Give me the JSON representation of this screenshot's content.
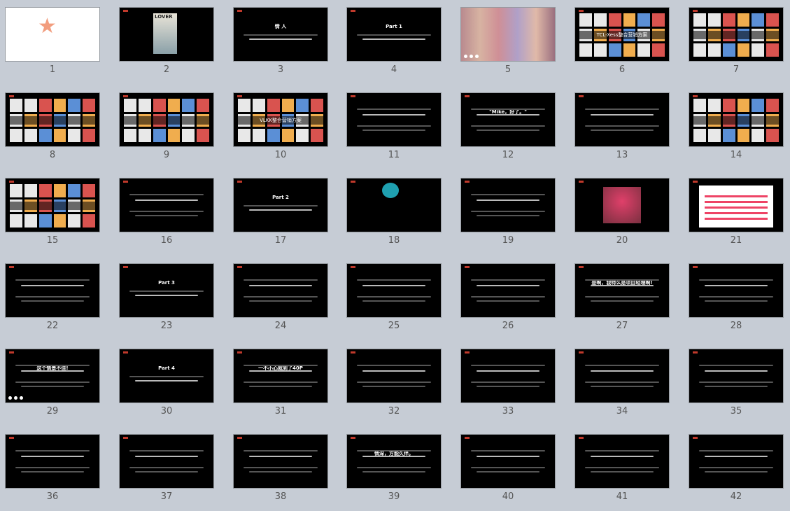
{
  "slides": [
    {
      "number": "1",
      "kind": "star",
      "text": ""
    },
    {
      "number": "2",
      "kind": "photo",
      "text": "LOVER"
    },
    {
      "number": "3",
      "kind": "title",
      "text": "情 人"
    },
    {
      "number": "4",
      "kind": "title",
      "text": "Part 1"
    },
    {
      "number": "5",
      "kind": "crowd",
      "text": ""
    },
    {
      "number": "6",
      "kind": "mosaic",
      "text": "TCL-Xess整合营销方案"
    },
    {
      "number": "7",
      "kind": "mosaic",
      "text": ""
    },
    {
      "number": "8",
      "kind": "mosaic",
      "text": ""
    },
    {
      "number": "9",
      "kind": "mosaic",
      "text": ""
    },
    {
      "number": "10",
      "kind": "mosaic",
      "text": "VLKK整合营销方案"
    },
    {
      "number": "11",
      "kind": "text",
      "text": ""
    },
    {
      "number": "12",
      "kind": "text",
      "text": "\"Mike，好了。\""
    },
    {
      "number": "13",
      "kind": "text",
      "text": ""
    },
    {
      "number": "14",
      "kind": "mosaic",
      "text": ""
    },
    {
      "number": "15",
      "kind": "mosaic",
      "text": ""
    },
    {
      "number": "16",
      "kind": "text",
      "text": ""
    },
    {
      "number": "17",
      "kind": "title",
      "text": "Part 2"
    },
    {
      "number": "18",
      "kind": "blob",
      "text": ""
    },
    {
      "number": "19",
      "kind": "text",
      "text": ""
    },
    {
      "number": "20",
      "kind": "pic",
      "text": ""
    },
    {
      "number": "21",
      "kind": "sheet",
      "text": ""
    },
    {
      "number": "22",
      "kind": "text",
      "text": ""
    },
    {
      "number": "23",
      "kind": "title",
      "text": "Part 3"
    },
    {
      "number": "24",
      "kind": "text",
      "text": ""
    },
    {
      "number": "25",
      "kind": "text",
      "text": ""
    },
    {
      "number": "26",
      "kind": "text",
      "text": ""
    },
    {
      "number": "27",
      "kind": "text",
      "text": "是啊，我特么是项目经理啊!"
    },
    {
      "number": "28",
      "kind": "text",
      "text": ""
    },
    {
      "number": "29",
      "kind": "text",
      "text": "这个情景不佳!"
    },
    {
      "number": "30",
      "kind": "title",
      "text": "Part 4"
    },
    {
      "number": "31",
      "kind": "text",
      "text": "一不小心就到了40P"
    },
    {
      "number": "32",
      "kind": "text",
      "text": ""
    },
    {
      "number": "33",
      "kind": "text",
      "text": ""
    },
    {
      "number": "34",
      "kind": "text",
      "text": ""
    },
    {
      "number": "35",
      "kind": "text",
      "text": ""
    },
    {
      "number": "36",
      "kind": "text",
      "text": ""
    },
    {
      "number": "37",
      "kind": "text",
      "text": ""
    },
    {
      "number": "38",
      "kind": "text",
      "text": ""
    },
    {
      "number": "39",
      "kind": "text",
      "text": "情深，方能久伴。"
    },
    {
      "number": "40",
      "kind": "text",
      "text": ""
    },
    {
      "number": "41",
      "kind": "text",
      "text": ""
    },
    {
      "number": "42",
      "kind": "text",
      "text": ""
    }
  ],
  "dots_on_slides": [
    "1",
    "5",
    "29"
  ]
}
